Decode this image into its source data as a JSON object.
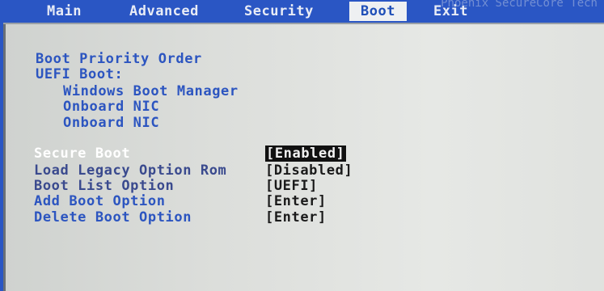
{
  "vendor_text": "Phoenix SecureCore Tech",
  "menu": {
    "tabs": [
      {
        "label": "Main"
      },
      {
        "label": "Advanced"
      },
      {
        "label": "Security"
      },
      {
        "label": "Boot"
      },
      {
        "label": "Exit"
      }
    ],
    "active": "Boot"
  },
  "boot_priority": {
    "heading": "Boot Priority Order",
    "uefi_label": "UEFI Boot:",
    "entries": [
      "Windows Boot Manager",
      "Onboard NIC",
      "Onboard NIC"
    ]
  },
  "settings": [
    {
      "label": "Secure Boot",
      "value": "[Enabled]",
      "selected": true
    },
    {
      "label": "Load Legacy Option Rom",
      "value": "[Disabled]"
    },
    {
      "label": "Boot List Option",
      "value": "[UEFI]"
    },
    {
      "label": "Add Boot Option",
      "value": "[Enter]"
    },
    {
      "label": "Delete Boot Option",
      "value": "[Enter]"
    }
  ],
  "colors": {
    "background_blue": "#2a56c4",
    "panel_gray": "#dcdedb",
    "text_blue": "#2c55c0",
    "highlight_white": "#ffffff"
  }
}
